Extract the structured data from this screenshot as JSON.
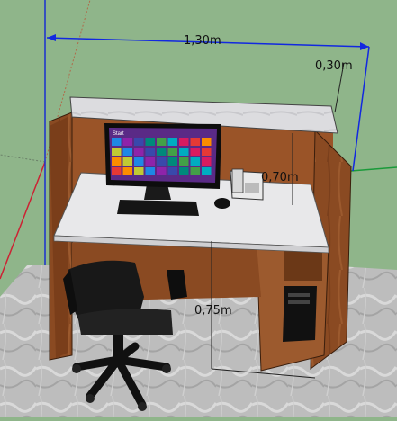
{
  "viewport": {
    "type": "3d-model-view",
    "background_color": "#8fb58a",
    "floor_color": "#b7b7b7"
  },
  "dimensions": {
    "width_label": "1,30m",
    "depth_label": "0,30m",
    "counter_height_label": "0,70m",
    "desk_height_label": "0,75m",
    "dimension_color": "#1228e0"
  },
  "monitor": {
    "screen_start_label": "Start",
    "tile_colors": [
      "#1e88e5",
      "#e53935",
      "#43a047",
      "#8e24aa",
      "#fb8c00",
      "#00acc1",
      "#3949ab",
      "#c0ca33",
      "#d81b60",
      "#00897b"
    ]
  },
  "objects": {
    "desk_color": "#8a4a22",
    "desktop_color": "#e8e8ea",
    "countertop_color": "#d9d9dc"
  }
}
